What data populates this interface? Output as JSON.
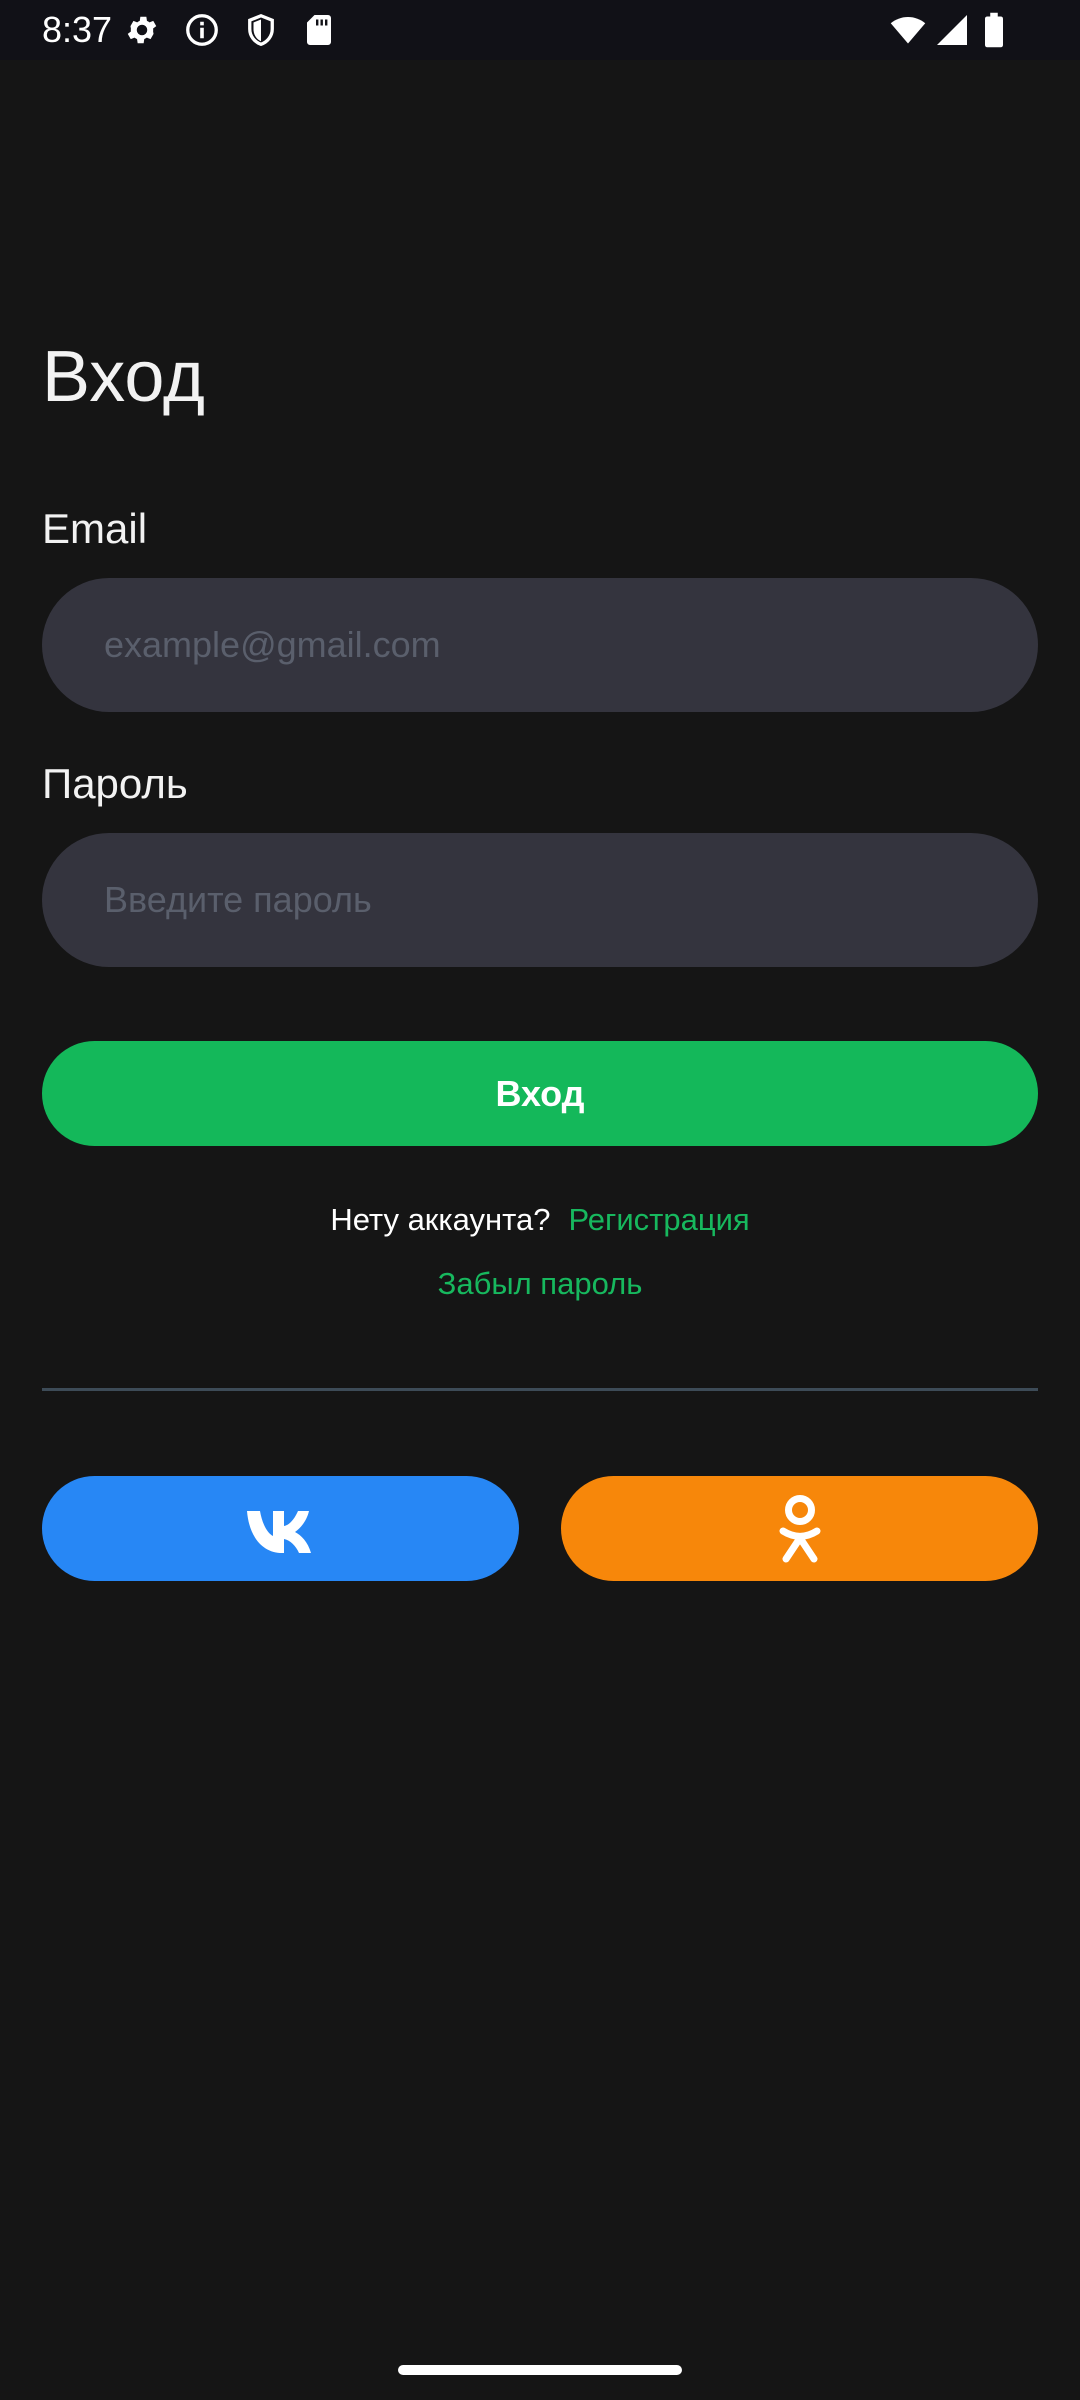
{
  "status_bar": {
    "time": "8:37",
    "left_icons": [
      "gear-icon",
      "info-icon",
      "shield-icon",
      "sd-card-icon"
    ],
    "right_icons": [
      "wifi-icon",
      "cell-signal-icon",
      "battery-icon"
    ]
  },
  "login": {
    "title": "Вход",
    "email_label": "Email",
    "email_placeholder": "example@gmail.com",
    "email_value": "",
    "password_label": "Пароль",
    "password_placeholder": "Введите пароль",
    "password_value": "",
    "submit_label": "Вход",
    "no_account_text": "Нету аккаунта?",
    "register_link": "Регистрация",
    "forgot_link": "Забыл пароль"
  },
  "social": {
    "vk": {
      "icon": "vk-logo-icon",
      "color": "#2787f5"
    },
    "ok": {
      "icon": "odnoklassniki-logo-icon",
      "color": "#f7870a"
    }
  },
  "colors": {
    "background": "#151515",
    "input_background": "#34343e",
    "accent_green": "#14b85a",
    "link_green": "#17b85e",
    "divider": "#3d4b57"
  }
}
